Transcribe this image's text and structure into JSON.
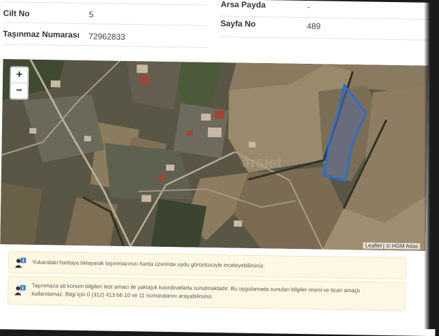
{
  "fields": {
    "arsa_payda_label": "Arsa Payda",
    "arsa_payda_value": "-",
    "cilt_no_label": "Cilt No",
    "cilt_no_value": "5",
    "sayfa_no_label": "Sayfa No",
    "sayfa_no_value": "489",
    "tasinmaz_no_label": "Taşınmaz Numarası",
    "tasinmaz_no_value": "72962833"
  },
  "map": {
    "zoom_in": "+",
    "zoom_out": "−",
    "attribution": "Leaflet | © HGM Atlas",
    "watermark": "arsiet",
    "parcel_color": "#1e6fe0"
  },
  "notes": [
    {
      "icon": "user-info-icon",
      "text": "Yukarıdaki haritaya tıklayarak taşınmazınızı harita üzerinde uydu görüntüsüyle inceleyebilirsiniz."
    },
    {
      "icon": "user-info-icon",
      "text_line1": "Taşınmaza ait konum bilgileri test amacı ile yaklaşık koordinatlarla sunulmaktadır. Bu uygulamada sunulan bilgiler resmi ve ticari amaçlı",
      "text_line2": "kullanılamaz. Bilgi için 0 (312) 413 66 10 ve 11 numaralarını arayabilirsiniz."
    }
  ]
}
